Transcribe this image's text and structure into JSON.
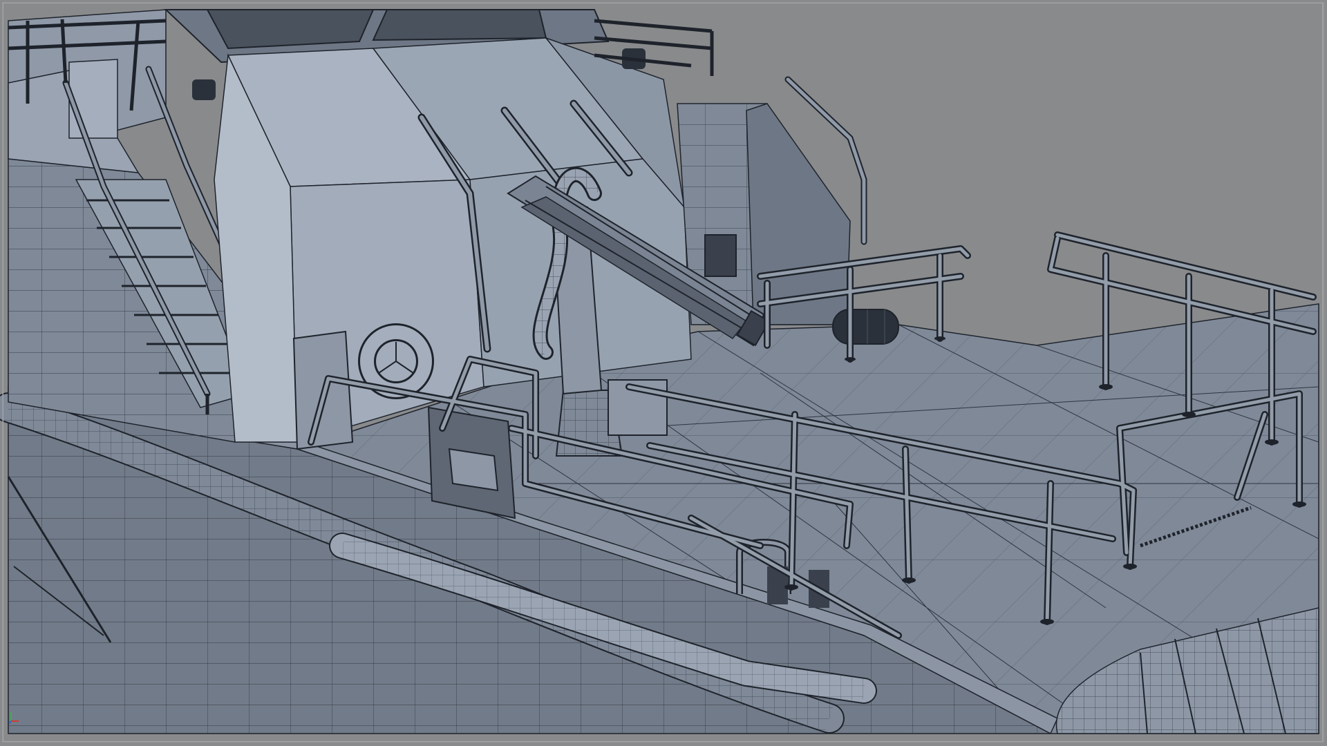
{
  "viewport": {
    "background_color": "#898a8c",
    "wire_color": "#1e232b",
    "hull_colors": {
      "light": "#a4aebd",
      "mid": "#8d97a6",
      "dark": "#6e7785",
      "deck": "#7f8998"
    }
  },
  "scene": {
    "subject": "ship-deck-wireframe",
    "visible_parts": [
      "wheelhouse",
      "deck-crane",
      "stairway",
      "life-ring",
      "deck-railing",
      "cylindrical-buoy",
      "rubber-fender",
      "mooring-bollard",
      "hull-rubbing-strake"
    ]
  },
  "axis_gizmo": {
    "icon": "axis-triad-icon",
    "colors": {
      "x": "#d23c2c",
      "y": "#38b048",
      "z": "#3a5fd0"
    }
  }
}
